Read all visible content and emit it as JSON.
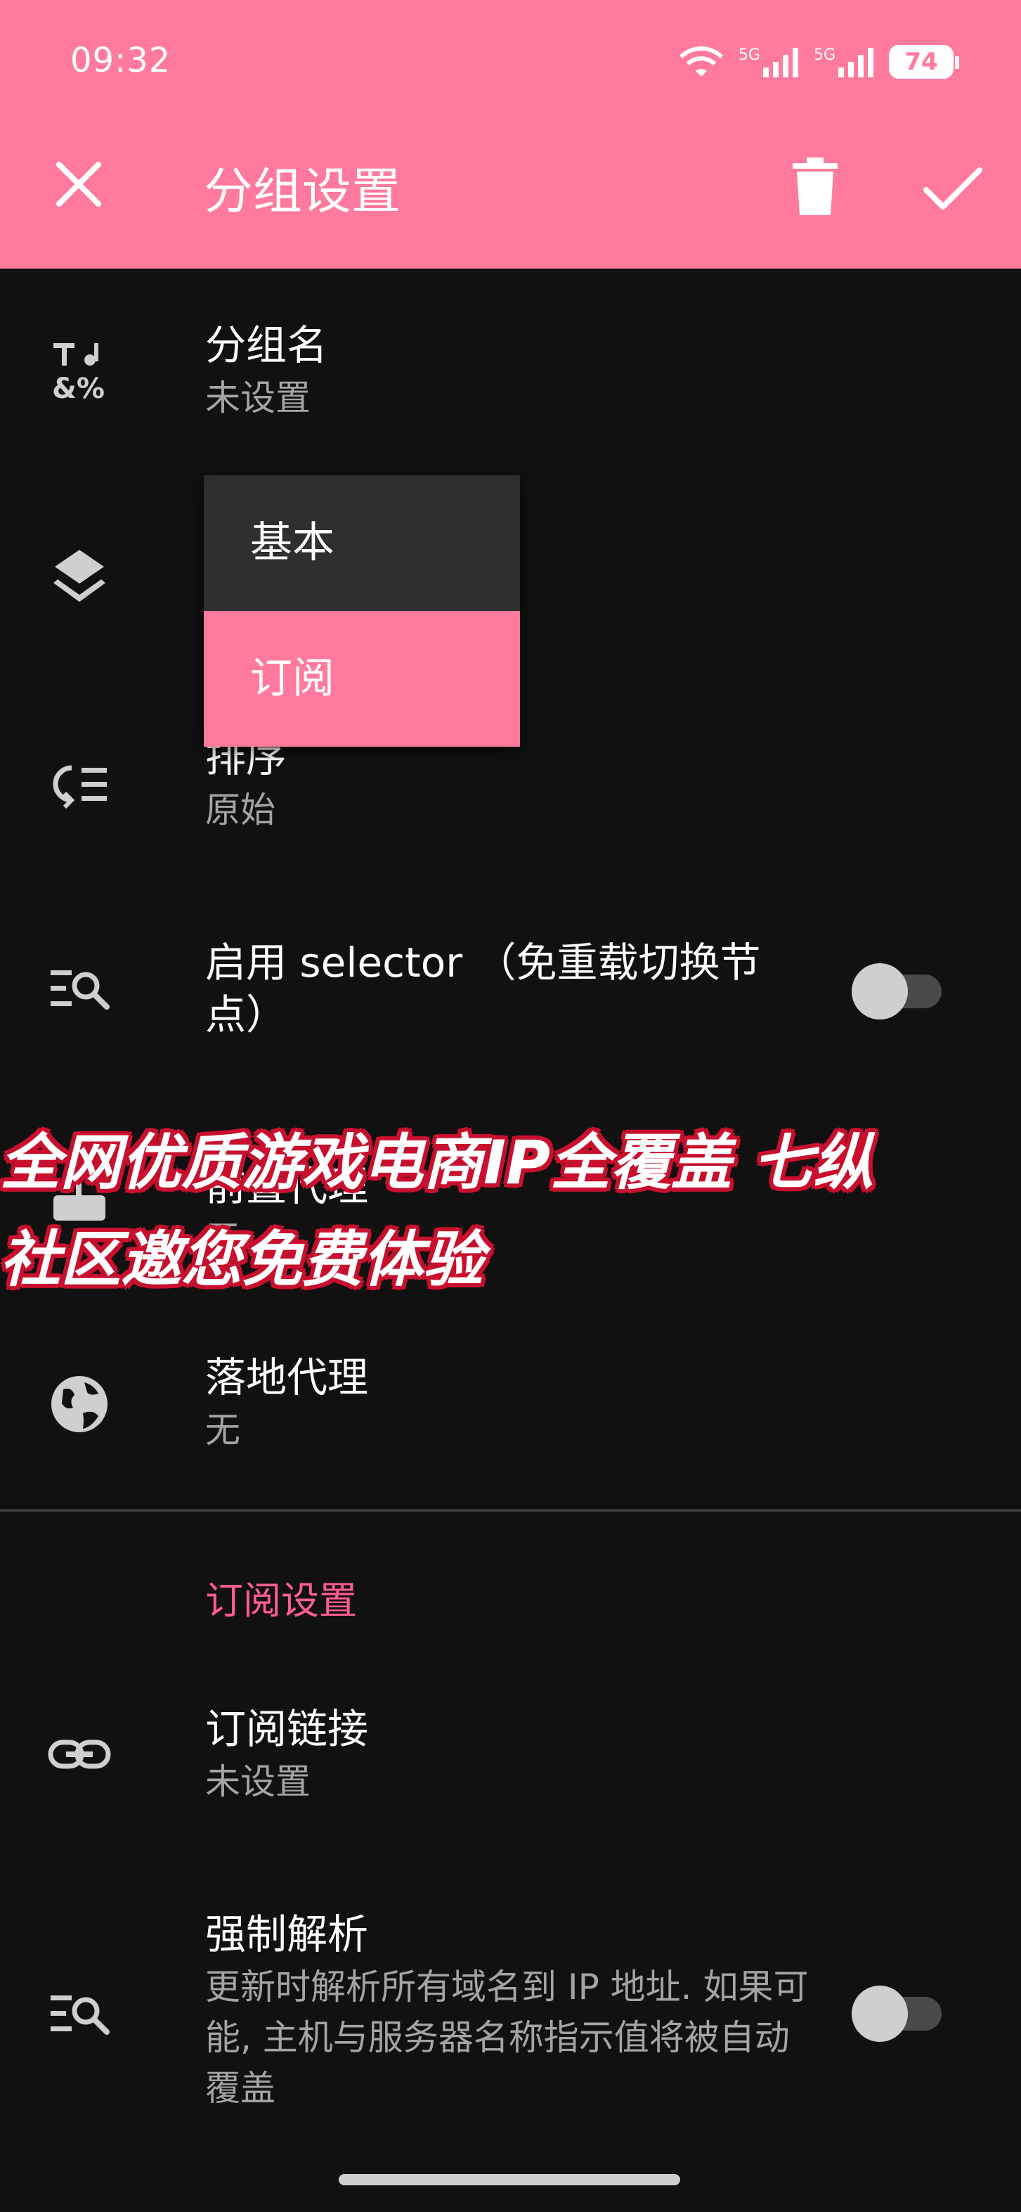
{
  "status_bar": {
    "time": "09:32",
    "battery": "74",
    "network_labels": [
      "5G",
      "5G"
    ]
  },
  "app_bar": {
    "title": "分组设置",
    "close_icon": "close-icon",
    "delete_icon": "trash-icon",
    "confirm_icon": "check-icon"
  },
  "rows": {
    "group_name": {
      "title": "分组名",
      "value": "未设置",
      "icon": "tag-icon"
    },
    "group_type": {
      "icon": "layers-icon"
    },
    "sort": {
      "title": "排序",
      "value": "原始",
      "icon": "sort-icon"
    },
    "selector": {
      "title": "启用 selector （免重载切换节点）",
      "icon": "search-list-icon",
      "toggle_on": false
    },
    "front_proxy": {
      "title": "前置代理",
      "value": "无",
      "icon": "router-icon"
    },
    "landing_proxy": {
      "title": "落地代理",
      "value": "无",
      "icon": "globe-icon"
    }
  },
  "subscription": {
    "header": "订阅设置",
    "link": {
      "title": "订阅链接",
      "value": "未设置",
      "icon": "link-icon"
    },
    "force_resolve": {
      "title": "强制解析",
      "description": "更新时解析所有域名到 IP 地址. 如果可能, 主机与服务器名称指示值将被自动覆盖",
      "icon": "search-list-icon",
      "toggle_on": false
    }
  },
  "popup": {
    "items": [
      "基本",
      "订阅"
    ],
    "selected_index": 1
  },
  "banner": {
    "line1": "全网优质游戏电商IP全覆盖 七纵",
    "line2": "社区邀您免费体验"
  },
  "colors": {
    "accent": "#ff7a9c",
    "section_header": "#ff5d8f",
    "background": "#111111",
    "banner_outline": "#c8102e"
  }
}
